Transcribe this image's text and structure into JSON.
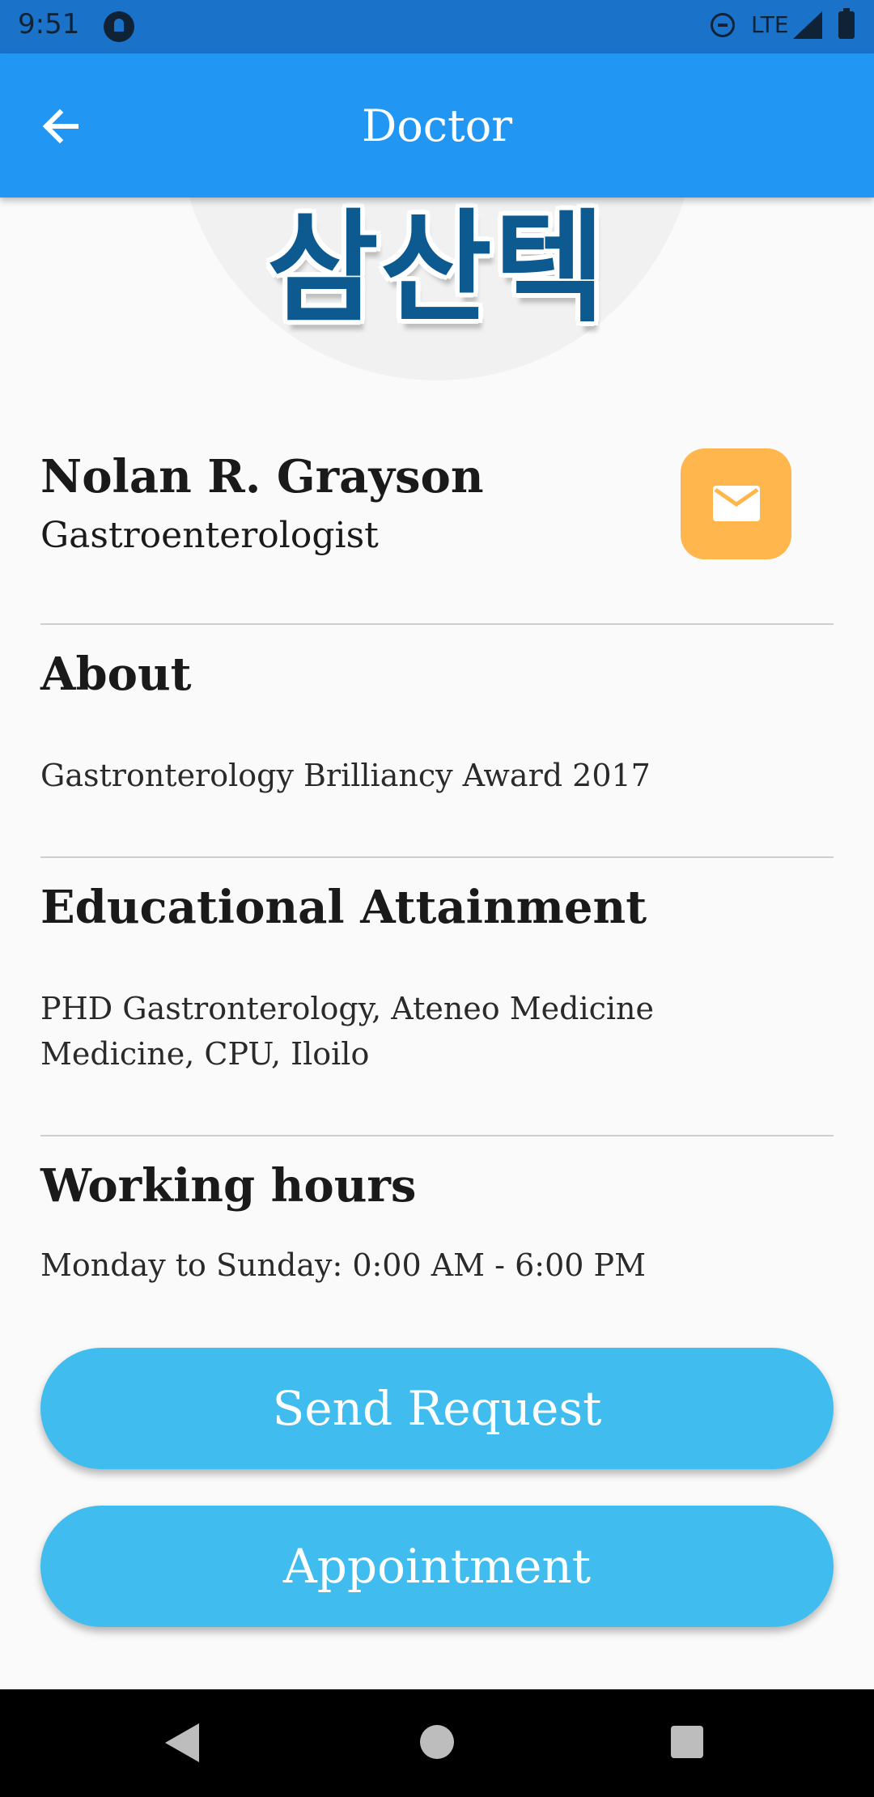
{
  "status_bar": {
    "time": "9:51",
    "network": "LTE"
  },
  "app_bar": {
    "title": "Doctor",
    "back_icon": "arrow-left-icon"
  },
  "logo": {
    "text": "삼산텍"
  },
  "doctor": {
    "name": "Nolan R. Grayson",
    "specialty": "Gastroenterologist",
    "message_icon": "mail-icon"
  },
  "about": {
    "title": "About",
    "text": "Gastronterology Brilliancy Award 2017"
  },
  "education": {
    "title": "Educational Attainment",
    "lines": [
      "PHD Gastronterology, Ateneo Medicine",
      "Medicine, CPU, Iloilo"
    ]
  },
  "working_hours": {
    "title": "Working hours",
    "text": "Monday to Sunday: 0:00 AM - 6:00 PM"
  },
  "buttons": {
    "send_request": "Send Request",
    "appointment": "Appointment"
  },
  "colors": {
    "status_bar": "#1a73c9",
    "app_bar": "#2196f3",
    "message_button": "#ffb74d",
    "pill_button": "#40bdee",
    "logo_text": "#0d5a91"
  },
  "nav_bar": {
    "back_icon": "triangle-back-icon",
    "home_icon": "circle-home-icon",
    "recents_icon": "square-recents-icon"
  }
}
